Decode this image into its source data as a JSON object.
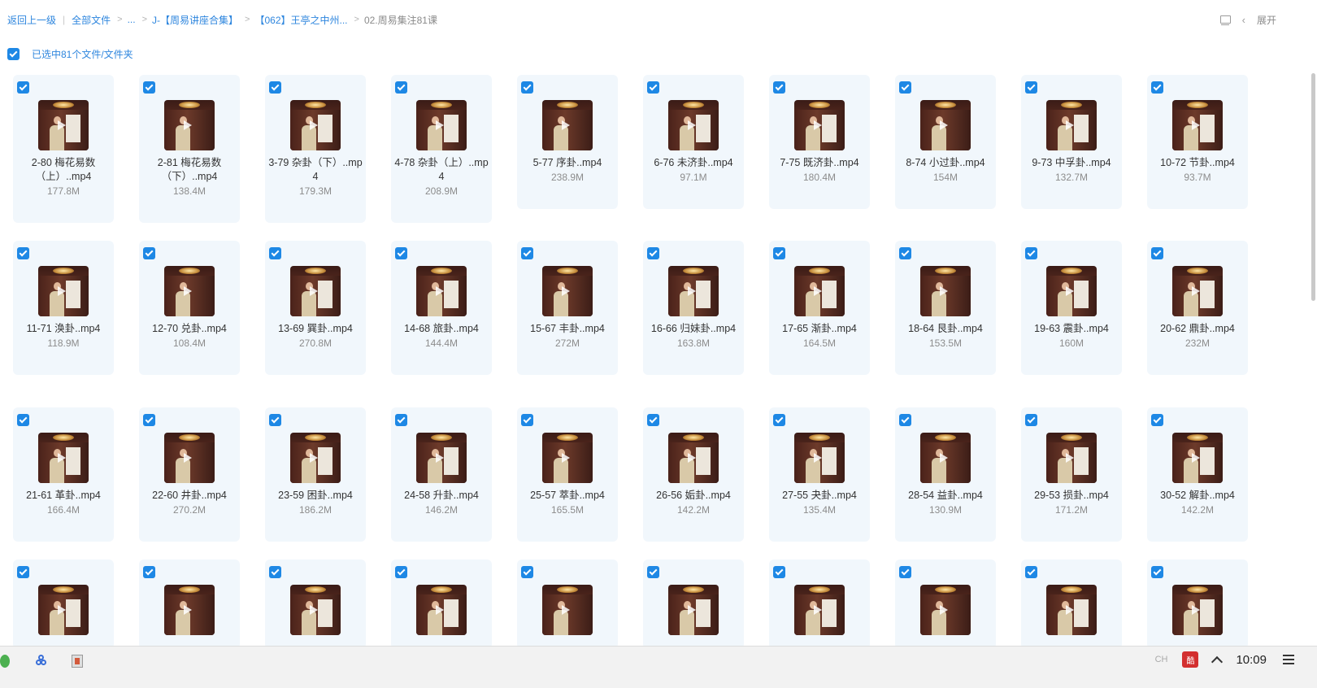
{
  "breadcrumb": {
    "back_label": "返回上一级",
    "all_files_label": "全部文件",
    "ellipsis": "...",
    "crumb1": "J-【周易讲座合集】",
    "crumb2": "【062】王亭之中州...",
    "current": "02.周易集注81课",
    "expand_label": "展开"
  },
  "selection": {
    "label": "已选中81个文件/文件夹"
  },
  "files": [
    {
      "name": "2-80 梅花易数（上）..mp4",
      "size": "177.8M"
    },
    {
      "name": "2-81 梅花易数（下）..mp4",
      "size": "138.4M"
    },
    {
      "name": "3-79 杂卦（下）..mp4",
      "size": "179.3M"
    },
    {
      "name": "4-78 杂卦（上）..mp4",
      "size": "208.9M"
    },
    {
      "name": "5-77 序卦..mp4",
      "size": "238.9M"
    },
    {
      "name": "6-76 未济卦..mp4",
      "size": "97.1M"
    },
    {
      "name": "7-75 既济卦..mp4",
      "size": "180.4M"
    },
    {
      "name": "8-74 小过卦..mp4",
      "size": "154M"
    },
    {
      "name": "9-73 中孚卦..mp4",
      "size": "132.7M"
    },
    {
      "name": "10-72 节卦..mp4",
      "size": "93.7M"
    },
    {
      "name": "11-71 涣卦..mp4",
      "size": "118.9M"
    },
    {
      "name": "12-70 兑卦..mp4",
      "size": "108.4M"
    },
    {
      "name": "13-69 巽卦..mp4",
      "size": "270.8M"
    },
    {
      "name": "14-68 旅卦..mp4",
      "size": "144.4M"
    },
    {
      "name": "15-67 丰卦..mp4",
      "size": "272M"
    },
    {
      "name": "16-66 归妹卦..mp4",
      "size": "163.8M"
    },
    {
      "name": "17-65 渐卦..mp4",
      "size": "164.5M"
    },
    {
      "name": "18-64 艮卦..mp4",
      "size": "153.5M"
    },
    {
      "name": "19-63 震卦..mp4",
      "size": "160M"
    },
    {
      "name": "20-62 鼎卦..mp4",
      "size": "232M"
    },
    {
      "name": "21-61 革卦..mp4",
      "size": "166.4M"
    },
    {
      "name": "22-60 井卦..mp4",
      "size": "270.2M"
    },
    {
      "name": "23-59 困卦..mp4",
      "size": "186.2M"
    },
    {
      "name": "24-58 升卦..mp4",
      "size": "146.2M"
    },
    {
      "name": "25-57 萃卦..mp4",
      "size": "165.5M"
    },
    {
      "name": "26-56 姤卦..mp4",
      "size": "142.2M"
    },
    {
      "name": "27-55 夬卦..mp4",
      "size": "135.4M"
    },
    {
      "name": "28-54 益卦..mp4",
      "size": "130.9M"
    },
    {
      "name": "29-53 损卦..mp4",
      "size": "171.2M"
    },
    {
      "name": "30-52 解卦..mp4",
      "size": "142.2M"
    },
    {
      "name": "",
      "size": ""
    },
    {
      "name": "",
      "size": ""
    },
    {
      "name": "",
      "size": ""
    },
    {
      "name": "",
      "size": ""
    },
    {
      "name": "",
      "size": ""
    },
    {
      "name": "",
      "size": ""
    },
    {
      "name": "",
      "size": ""
    },
    {
      "name": "",
      "size": ""
    },
    {
      "name": "",
      "size": ""
    },
    {
      "name": "",
      "size": ""
    }
  ],
  "taskbar": {
    "ime": "CH",
    "seal": "酷",
    "clock": "10:09"
  },
  "colors": {
    "accent": "#1e88e5",
    "link": "#2e86de",
    "card_bg": "#f1f7fc"
  }
}
